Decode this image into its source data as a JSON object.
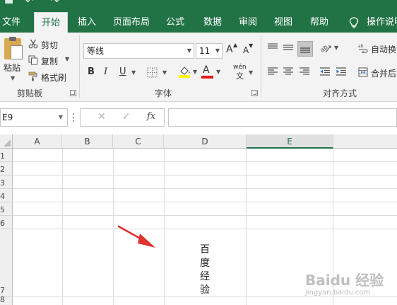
{
  "title_bar": {
    "qat_undo": "↶",
    "qat_redo": "↷"
  },
  "tabs": [
    {
      "label": "文件"
    },
    {
      "label": "开始"
    },
    {
      "label": "插入"
    },
    {
      "label": "页面布局"
    },
    {
      "label": "公式"
    },
    {
      "label": "数据"
    },
    {
      "label": "审阅"
    },
    {
      "label": "视图"
    },
    {
      "label": "帮助"
    }
  ],
  "tell_me": {
    "label": "操作说明"
  },
  "clipboard": {
    "paste_label": "粘贴",
    "cut_label": "剪切",
    "copy_label": "复制",
    "format_painter_label": "格式刷",
    "group_label": "剪贴板"
  },
  "font": {
    "name": "等线",
    "size": "11",
    "grow_label": "A",
    "shrink_label": "A",
    "bold_label": "B",
    "italic_label": "I",
    "underline_label": "U",
    "color_label": "A",
    "phonetic_label": "wén",
    "phonetic_sub": "文",
    "group_label": "字体"
  },
  "alignment": {
    "wrap_label": "自动换",
    "merge_label": "合并后",
    "group_label": "对齐方式"
  },
  "formula_bar": {
    "name_box": "E9",
    "cancel_label": "✕",
    "confirm_label": "✓",
    "fx_label": "fx",
    "formula": ""
  },
  "grid": {
    "columns": [
      "A",
      "B",
      "C",
      "D",
      "E"
    ],
    "rows": [
      "1",
      "2",
      "3",
      "4",
      "5",
      "6",
      "7",
      "8"
    ],
    "selected_column": "E",
    "cell_d7_chars": [
      "百",
      "度",
      "经",
      "验"
    ]
  },
  "colors": {
    "accent": "#217346",
    "ribbon_bg": "#f3f3f3",
    "arrow": "#e0322e",
    "font_highlight": "#ffff00",
    "font_color": "#e21b1b"
  },
  "watermark": {
    "main": "Baidu 经验",
    "sub": "jingyan.baidu.com"
  }
}
